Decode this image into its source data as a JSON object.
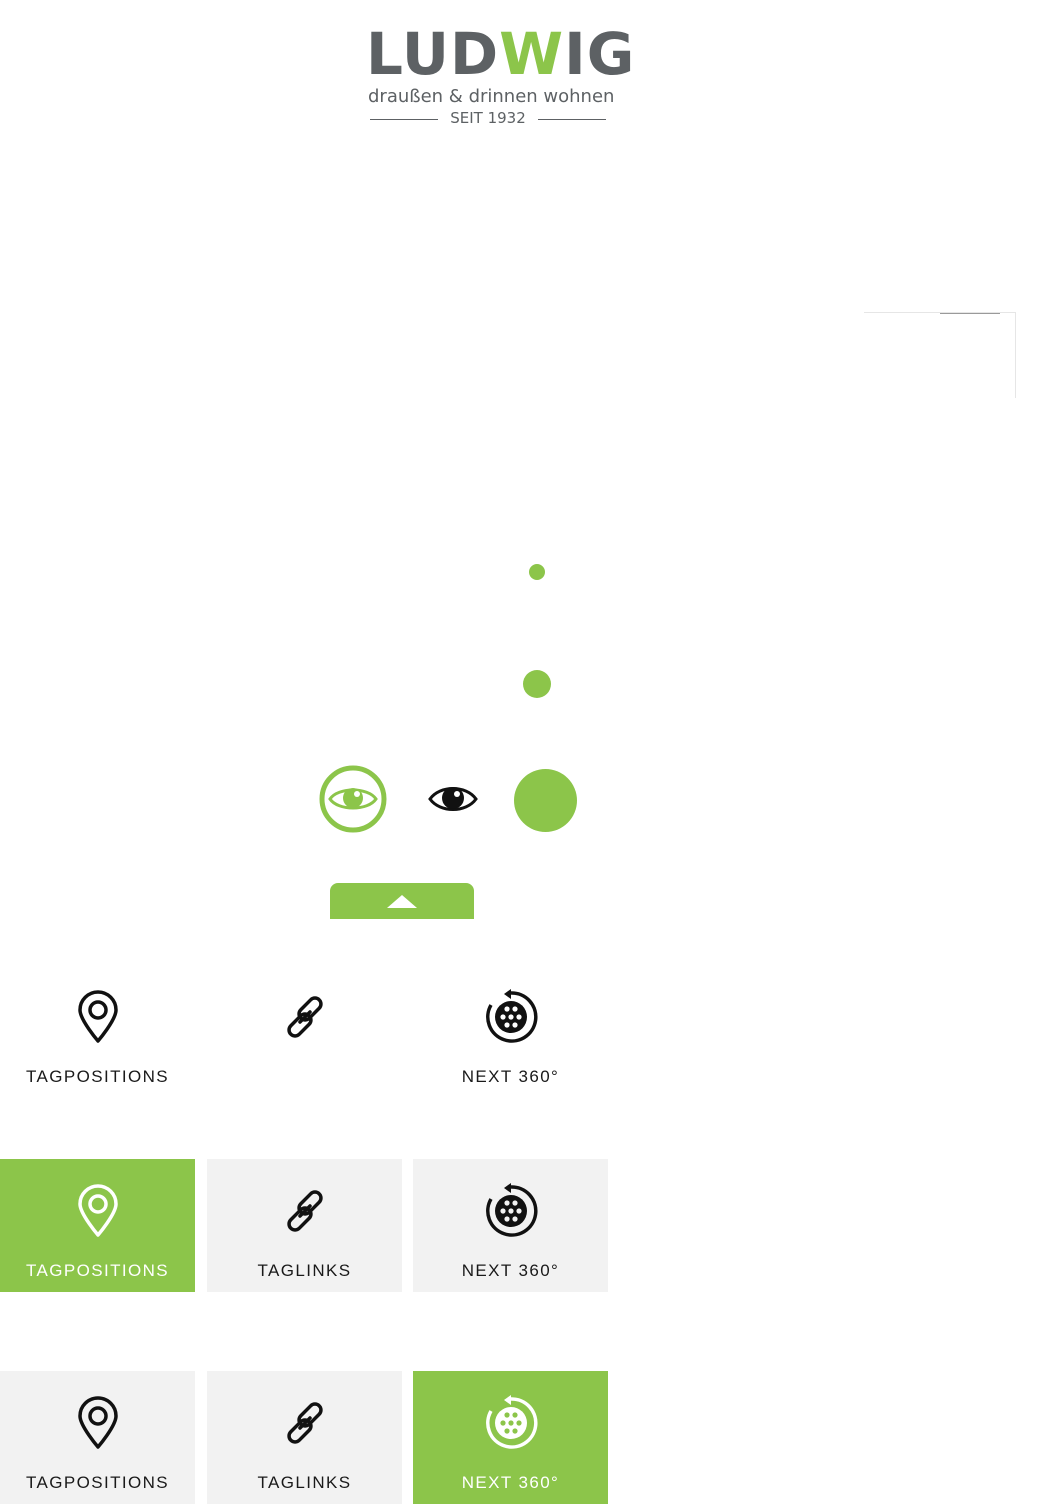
{
  "logo": {
    "word_start": "LUD",
    "word_w": "W",
    "word_end": "IG",
    "tagline": "draußen & drinnen wohnen",
    "since": "SEIT 1932"
  },
  "colors": {
    "accent": "#8cc54a",
    "tile_bg": "#f2f2f2",
    "text": "#1a1a1a",
    "logo_grey": "#5d6164"
  },
  "icons": {
    "eye_active": "eye-circle-icon",
    "eye_plain": "eye-icon",
    "collapse": "chevron-up-icon",
    "tagpositions": "map-pin-icon",
    "taglinks": "link-icon",
    "next360": "rotate-360-icon"
  },
  "rows": [
    {
      "variant": "plain",
      "tiles": [
        {
          "label": "TAGPOSITIONS",
          "state": "plain"
        },
        {
          "label": "",
          "state": "plain"
        },
        {
          "label": "NEXT 360°",
          "state": "plain"
        }
      ]
    },
    {
      "variant": "tagpositions-active",
      "tiles": [
        {
          "label": "TAGPOSITIONS",
          "state": "active"
        },
        {
          "label": "TAGLINKS",
          "state": "inactive"
        },
        {
          "label": "NEXT 360°",
          "state": "inactive"
        }
      ]
    },
    {
      "variant": "next360-active",
      "tiles": [
        {
          "label": "TAGPOSITIONS",
          "state": "inactive"
        },
        {
          "label": "TAGLINKS",
          "state": "inactive"
        },
        {
          "label": "NEXT 360°",
          "state": "active"
        }
      ]
    }
  ]
}
